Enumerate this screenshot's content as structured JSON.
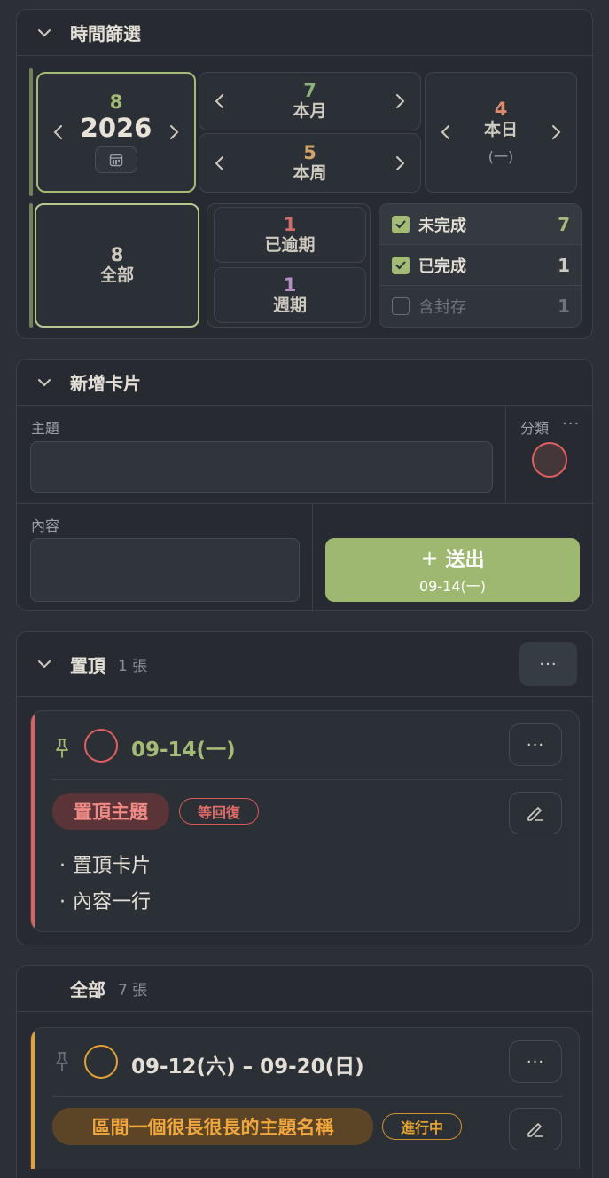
{
  "time_filter": {
    "title": "時間篩選",
    "year": {
      "count": "8",
      "label": "2026"
    },
    "month": {
      "count": "7",
      "label": "本月"
    },
    "week": {
      "count": "5",
      "label": "本周"
    },
    "day": {
      "count": "4",
      "label": "本日",
      "sub": "(一)"
    },
    "all": {
      "count": "8",
      "label": "全部"
    },
    "overdue": {
      "count": "1",
      "label": "已逾期"
    },
    "recurring": {
      "count": "1",
      "label": "週期"
    },
    "status": [
      {
        "label": "未完成",
        "count": "7",
        "checked": true
      },
      {
        "label": "已完成",
        "count": "1",
        "checked": true
      },
      {
        "label": "含封存",
        "count": "1",
        "checked": false
      }
    ]
  },
  "new_card": {
    "title": "新增卡片",
    "subject_label": "主題",
    "category_label": "分類",
    "content_label": "內容",
    "submit_label": "送出",
    "submit_date": "09-14(一)"
  },
  "pinned": {
    "title": "置頂",
    "count": "1 張",
    "card": {
      "date": "09-14(一)",
      "subject": "置頂主題",
      "status": "等回復",
      "lines": [
        "置頂卡片",
        "內容一行"
      ]
    }
  },
  "all_cards": {
    "title": "全部",
    "count": "7 張",
    "card": {
      "date": "09-12(六) – 09-20(日)",
      "subject": "區間一個很長很長的主題名稱",
      "status": "進行中"
    }
  },
  "colors": {
    "green": "#a3bb74",
    "red": "#e0605e",
    "orange": "#e4a330",
    "accent_button": "#9fb86f"
  }
}
